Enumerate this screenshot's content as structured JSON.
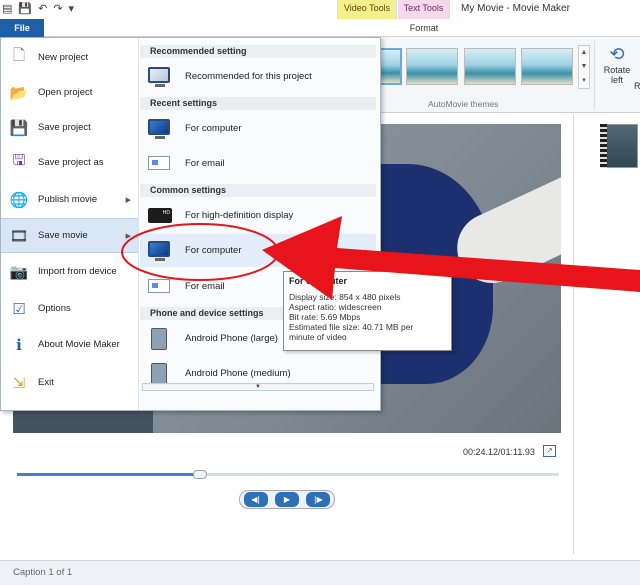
{
  "window": {
    "title": "My Movie - Movie Maker",
    "context_tabs": {
      "video_tools": "Video Tools",
      "text_tools": "Text Tools"
    },
    "tabs": {
      "file": "File",
      "format": "Format"
    }
  },
  "ribbon": {
    "themes_label": "AutoMovie themes",
    "rotate_left": "Rotate\nleft",
    "rotate_left_line1": "Rotate",
    "rotate_left_line2": "left",
    "rotate_right_fragment": "R"
  },
  "file_menu": {
    "items": [
      {
        "label": "New project",
        "icon": "new-project-icon"
      },
      {
        "label": "Open project",
        "icon": "open-folder-icon"
      },
      {
        "label": "Save project",
        "icon": "save-disk-icon"
      },
      {
        "label": "Save project as",
        "icon": "save-as-icon"
      },
      {
        "label": "Publish movie",
        "icon": "globe-icon",
        "submenu": true
      },
      {
        "label": "Save movie",
        "icon": "film-icon",
        "submenu": true
      },
      {
        "label": "Import from device",
        "icon": "camera-import-icon"
      },
      {
        "label": "Options",
        "icon": "options-list-icon"
      },
      {
        "label": "About Movie Maker",
        "icon": "info-icon"
      },
      {
        "label": "Exit",
        "icon": "exit-icon"
      }
    ],
    "submenu": {
      "recommended_header": "Recommended setting",
      "recommended_item": "Recommended for this project",
      "recent_header": "Recent settings",
      "recent_items": [
        "For computer",
        "For email"
      ],
      "common_header": "Common settings",
      "common_items": [
        "For high-definition display",
        "For computer",
        "For email"
      ],
      "phone_header": "Phone and device settings",
      "phone_items": [
        "Android Phone (large)",
        "Android Phone (medium)"
      ]
    }
  },
  "tooltip": {
    "title": "For computer",
    "lines": [
      "Display size: 854 x 480 pixels",
      "Aspect ratio: widescreen",
      "Bit rate: 5.69 Mbps",
      "Estimated file size: 40.71 MB per",
      "minute of video"
    ]
  },
  "player": {
    "timecode": "00:24.12/01:11.93",
    "progress_fraction": 0.337
  },
  "status": {
    "caption": "Caption 1 of 1"
  },
  "colors": {
    "accent": "#1f5fa8",
    "annotation_red": "#e8141b"
  }
}
